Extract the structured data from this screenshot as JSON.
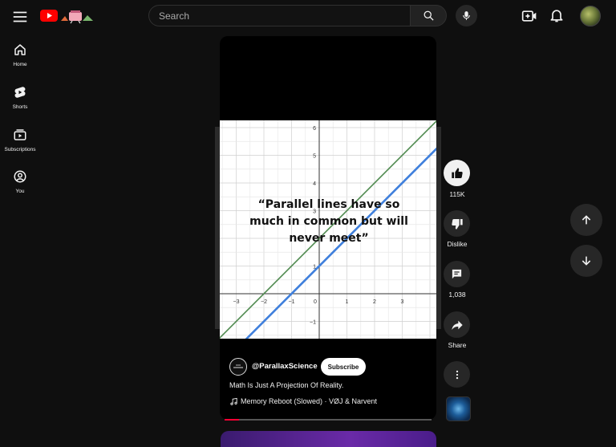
{
  "header": {
    "search_placeholder": "Search",
    "logo_colors": {
      "play": "#ff0000"
    }
  },
  "sidebar": {
    "items": [
      {
        "label": "Home",
        "icon": "home-icon"
      },
      {
        "label": "Shorts",
        "icon": "shorts-icon"
      },
      {
        "label": "Subscriptions",
        "icon": "subscriptions-icon"
      },
      {
        "label": "You",
        "icon": "you-icon"
      }
    ]
  },
  "short": {
    "quote": "“Parallel lines have so much in common but will never meet”",
    "graph": {
      "x_ticks": [
        "−3",
        "−2",
        "−1",
        "0",
        "1",
        "2",
        "3"
      ],
      "y_ticks": [
        "6",
        "5",
        "4",
        "3",
        "1",
        "−1"
      ],
      "lines": [
        {
          "color": "#4f8a4f",
          "slope": 1,
          "intercept": 2
        },
        {
          "color": "#3f7fdc",
          "slope": 1,
          "intercept": 1
        }
      ]
    },
    "channel": "@ParallaxScience",
    "subscribe_label": "Subscribe",
    "caption": "Math Is Just A Projection Of Reality.",
    "music": "Memory Reboot (Slowed) · VØJ & Narvent",
    "progress": 0.07,
    "accent_color": "#ff0033"
  },
  "actions": {
    "like_count": "115K",
    "dislike_label": "Dislike",
    "comment_count": "1,038",
    "share_label": "Share"
  }
}
